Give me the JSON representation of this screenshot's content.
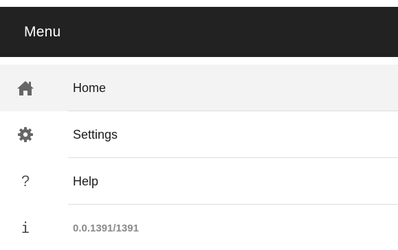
{
  "header": {
    "title": "Menu"
  },
  "menu": {
    "items": [
      {
        "label": "Home",
        "icon": "home-icon",
        "active": true
      },
      {
        "label": "Settings",
        "icon": "gear-icon",
        "active": false
      },
      {
        "label": "Help",
        "icon": "question-mark-icon",
        "icon_glyph": "?",
        "active": false
      }
    ],
    "version": {
      "icon": "info-icon",
      "icon_glyph": "i",
      "text": "0.0.1391/1391"
    }
  },
  "colors": {
    "header_bg": "#222222",
    "active_bg": "#f3f3f3",
    "divider": "#dcdcdc",
    "icon": "#666666"
  }
}
